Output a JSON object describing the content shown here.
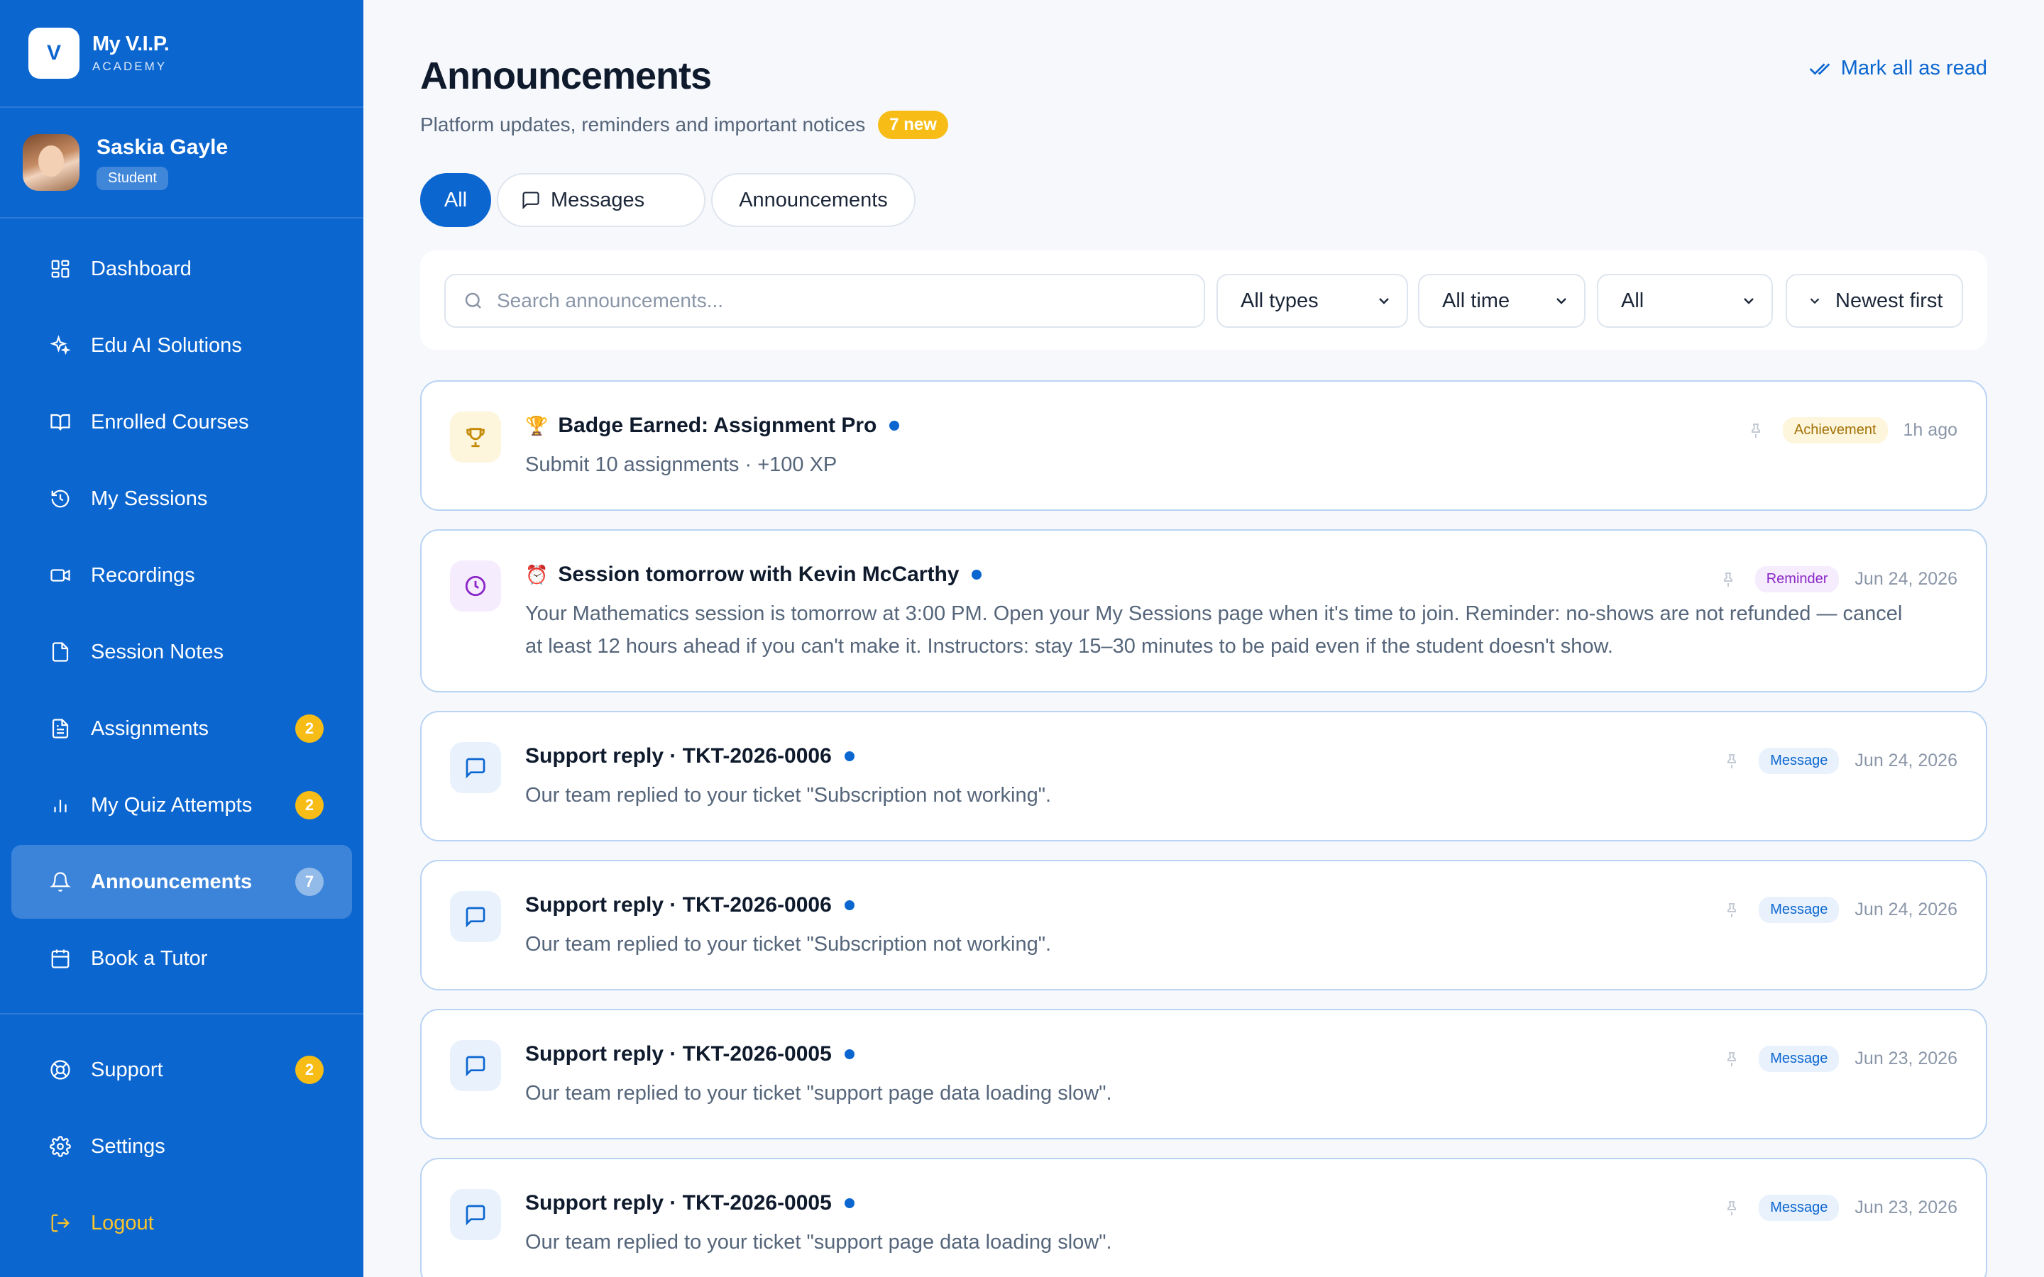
{
  "brand": {
    "logo_letter": "V",
    "name": "My V.I.P.",
    "sub": "ACADEMY"
  },
  "profile": {
    "name": "Saskia Gayle",
    "role": "Student"
  },
  "nav": [
    {
      "label": "Dashboard",
      "icon": "dashboard-icon"
    },
    {
      "label": "Edu AI Solutions",
      "icon": "sparkles-icon"
    },
    {
      "label": "Enrolled Courses",
      "icon": "book-open-icon"
    },
    {
      "label": "My Sessions",
      "icon": "history-icon"
    },
    {
      "label": "Recordings",
      "icon": "video-icon"
    },
    {
      "label": "Session Notes",
      "icon": "file-icon"
    },
    {
      "label": "Assignments",
      "icon": "file-text-icon",
      "badge": "2"
    },
    {
      "label": "My Quiz Attempts",
      "icon": "bar-chart-icon",
      "badge": "2"
    },
    {
      "label": "Announcements",
      "icon": "bell-icon",
      "badge": "7",
      "active": true
    },
    {
      "label": "Book a Tutor",
      "icon": "calendar-icon"
    }
  ],
  "nav_bottom": [
    {
      "label": "Support",
      "icon": "lifebuoy-icon",
      "badge": "2"
    },
    {
      "label": "Settings",
      "icon": "gear-icon"
    },
    {
      "label": "Logout",
      "icon": "logout-icon"
    }
  ],
  "header": {
    "title": "Announcements",
    "subtitle": "Platform updates, reminders and important notices",
    "new_count": "7 new",
    "mark_all": "Mark all as read"
  },
  "tabs": {
    "all": "All",
    "messages": "Messages",
    "announcements": "Announcements"
  },
  "filters": {
    "search_placeholder": "Search announcements...",
    "type": "All types",
    "time": "All time",
    "status": "All",
    "sort": "Newest first"
  },
  "colors": {
    "primary": "#0b66d0",
    "accent": "#f7bd16",
    "card_border": "#b9d3f3"
  },
  "cards": [
    {
      "emoji": "🏆",
      "title": "Badge Earned: Assignment Pro",
      "text": "Submit 10 assignments · +100 XP",
      "tag": "Achievement",
      "time": "1h ago",
      "icon": "trophy-icon"
    },
    {
      "emoji": "⏰",
      "title": "Session tomorrow with Kevin McCarthy",
      "text": "Your Mathematics session is tomorrow at 3:00 PM. Open your My Sessions page when it's time to join. Reminder: no-shows are not refunded — cancel at least 12 hours ahead if you can't make it. Instructors: stay 15–30 minutes to be paid even if the student doesn't show.",
      "tag": "Reminder",
      "time": "Jun 24, 2026",
      "icon": "clock-icon"
    },
    {
      "title": "Support reply · TKT-2026-0006",
      "text": "Our team replied to your ticket \"Subscription not working\".",
      "tag": "Message",
      "time": "Jun 24, 2026",
      "icon": "message-icon"
    },
    {
      "title": "Support reply · TKT-2026-0006",
      "text": "Our team replied to your ticket \"Subscription not working\".",
      "tag": "Message",
      "time": "Jun 24, 2026",
      "icon": "message-icon"
    },
    {
      "title": "Support reply · TKT-2026-0005",
      "text": "Our team replied to your ticket \"support page data loading slow\".",
      "tag": "Message",
      "time": "Jun 23, 2026",
      "icon": "message-icon"
    },
    {
      "title": "Support reply · TKT-2026-0005",
      "text": "Our team replied to your ticket \"support page data loading slow\".",
      "tag": "Message",
      "time": "Jun 23, 2026",
      "icon": "message-icon"
    }
  ]
}
